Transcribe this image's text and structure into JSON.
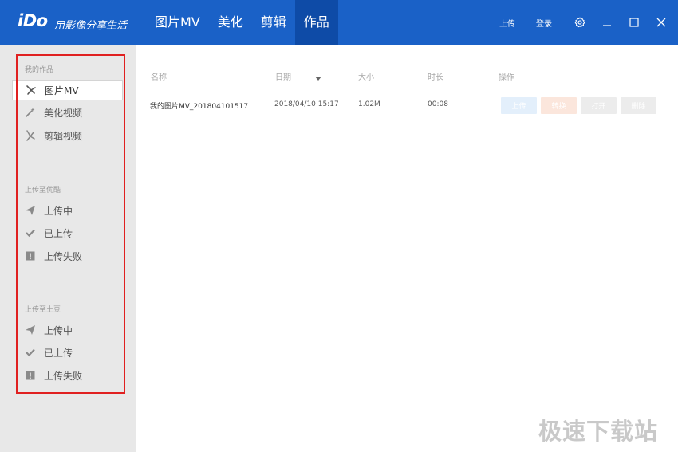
{
  "app": {
    "logo": "iDo",
    "slogan": "用影像分享生活"
  },
  "nav": {
    "items": [
      {
        "label": "图片MV",
        "active": false
      },
      {
        "label": "美化",
        "active": false
      },
      {
        "label": "剪辑",
        "active": false
      },
      {
        "label": "作品",
        "active": true
      }
    ]
  },
  "topbar": {
    "upload_label": "上传",
    "login_label": "登录"
  },
  "window_controls": [
    "gear-icon",
    "minimize-icon",
    "maximize-icon",
    "close-icon"
  ],
  "sidebar": {
    "sections": [
      {
        "title": "我的作品",
        "items": [
          {
            "label": "图片MV",
            "icon": "scissors-fan-icon",
            "active": true
          },
          {
            "label": "美化视频",
            "icon": "magic-wand-icon",
            "active": false
          },
          {
            "label": "剪辑视频",
            "icon": "scissors-icon",
            "active": false
          }
        ]
      },
      {
        "title": "上传至优酷",
        "items": [
          {
            "label": "上传中",
            "icon": "paper-plane-icon"
          },
          {
            "label": "已上传",
            "icon": "checkmark-icon"
          },
          {
            "label": "上传失败",
            "icon": "exclamation-icon"
          }
        ]
      },
      {
        "title": "上传至土豆",
        "items": [
          {
            "label": "上传中",
            "icon": "paper-plane-icon"
          },
          {
            "label": "已上传",
            "icon": "checkmark-icon"
          },
          {
            "label": "上传失败",
            "icon": "exclamation-icon"
          }
        ]
      }
    ]
  },
  "table": {
    "columns": [
      "名称",
      "日期",
      "大小",
      "时长",
      "操作"
    ],
    "sort_column": "日期",
    "rows": [
      {
        "name": "我的图片MV_201804101517",
        "date": "2018/04/10 15:17",
        "size": "1.02M",
        "duration": "00:08",
        "actions": [
          {
            "label": "上传",
            "color": "#e3effb"
          },
          {
            "label": "转换",
            "color": "#fbe6dc"
          },
          {
            "label": "打开",
            "color": "#ececec"
          },
          {
            "label": "删除",
            "color": "#ececec"
          }
        ]
      }
    ]
  },
  "colors": {
    "titlebar": "#1a61c7",
    "nav_active": "#0e4ba7",
    "sidebar_bg": "#e8e8e8",
    "highlight_frame": "#e02020"
  },
  "watermark": "极速下载站"
}
